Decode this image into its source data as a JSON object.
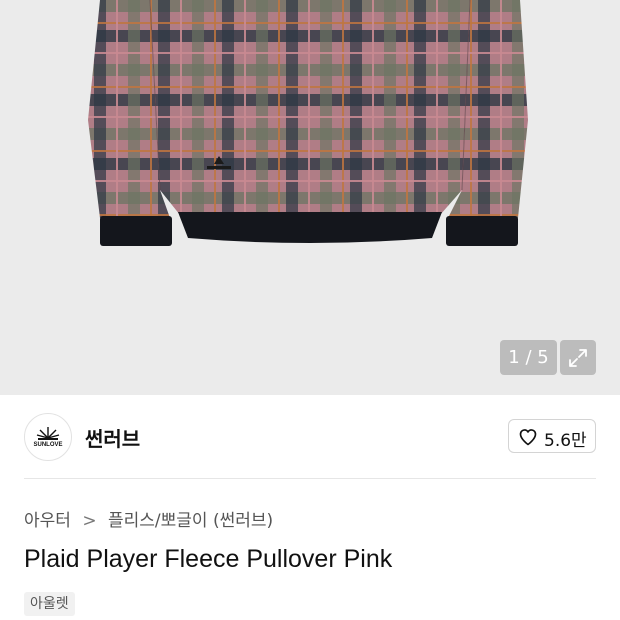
{
  "gallery": {
    "pager_text": "1 / 5",
    "current_index": 1,
    "total": 5,
    "expand_icon": "expand-icon",
    "garment_label": "SUNLOVE"
  },
  "brand": {
    "logo_text": "SUNLOVE",
    "name": "썬러브",
    "like_icon": "heart-icon",
    "like_count": "5.6만"
  },
  "breadcrumb": {
    "items": [
      "아우터",
      "플리스/뽀글이 (썬러브)"
    ],
    "separator": ">"
  },
  "product": {
    "title": "Plaid Player Fleece Pullover Pink",
    "tag": "아울렛"
  },
  "colors": {
    "hero_bg": "#ebebeb",
    "plaid_base": "#b07d86",
    "plaid_dark": "#2e3844",
    "plaid_green": "#6c7562",
    "plaid_orange": "#c0763f",
    "rib": "#14161c"
  }
}
